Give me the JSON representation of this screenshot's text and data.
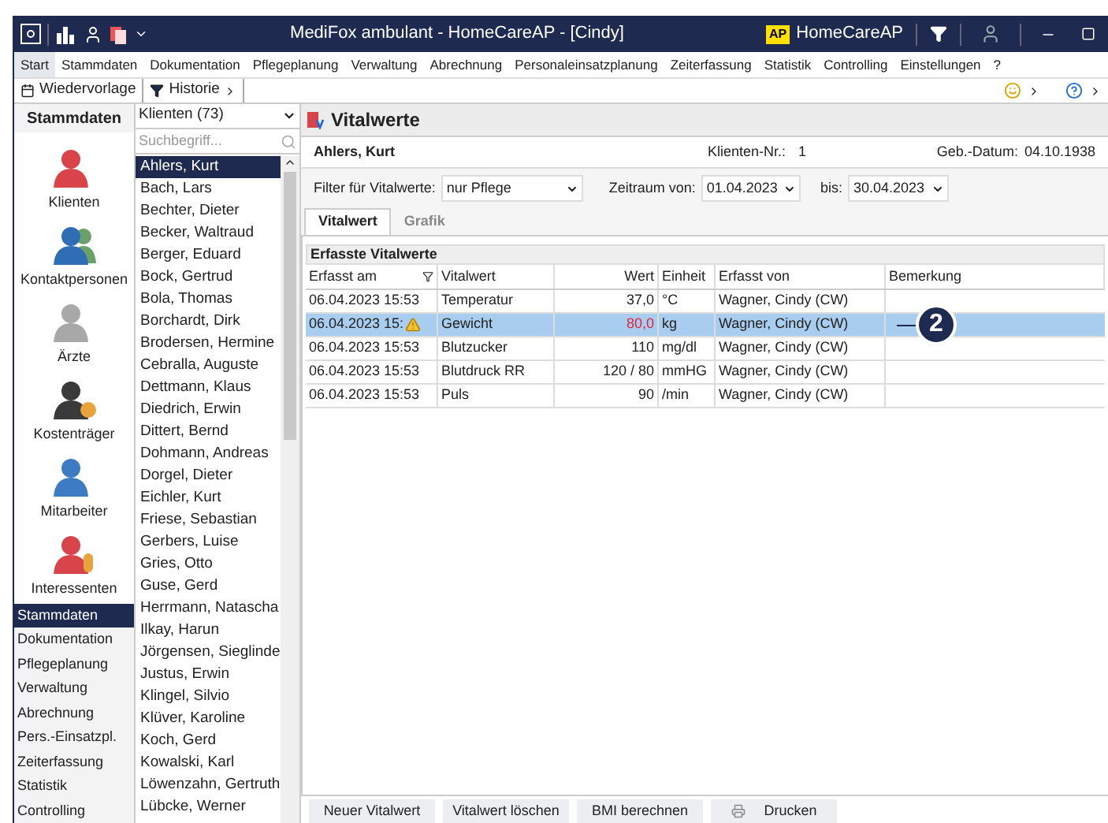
{
  "window": {
    "title": "MediFox ambulant  -  HomeCareAP - [Cindy]",
    "badge": "AP",
    "account": "HomeCareAP"
  },
  "menu": [
    {
      "label": "Start",
      "selected": true
    },
    {
      "label": "Stammdaten",
      "selected": false
    },
    {
      "label": "Dokumentation",
      "selected": false
    },
    {
      "label": "Pflegeplanung",
      "selected": false
    },
    {
      "label": "Verwaltung",
      "selected": false
    },
    {
      "label": "Abrechnung",
      "selected": false
    },
    {
      "label": "Personaleinsatzplanung",
      "selected": false
    },
    {
      "label": "Zeiterfassung",
      "selected": false
    },
    {
      "label": "Statistik",
      "selected": false
    },
    {
      "label": "Controlling",
      "selected": false
    },
    {
      "label": "Einstellungen",
      "selected": false
    },
    {
      "label": "?",
      "selected": false
    }
  ],
  "toolbar": [
    {
      "label": "Wiedervorlage",
      "kind": "calendar"
    },
    {
      "label": "Historie",
      "kind": "filter"
    }
  ],
  "nav": {
    "header": "Stammdaten",
    "modules": [
      {
        "label": "Klienten",
        "kind": "client"
      },
      {
        "label": "Kontaktpersonen",
        "kind": "contacts"
      },
      {
        "label": "Ärzte",
        "kind": "doctor"
      },
      {
        "label": "Kostenträger",
        "kind": "payer"
      },
      {
        "label": "Mitarbeiter",
        "kind": "staff"
      },
      {
        "label": "Interessenten",
        "kind": "prospect"
      }
    ],
    "sections": [
      {
        "label": "Stammdaten",
        "selected": true
      },
      {
        "label": "Dokumentation",
        "selected": false
      },
      {
        "label": "Pflegeplanung",
        "selected": false
      },
      {
        "label": "Verwaltung",
        "selected": false
      },
      {
        "label": "Abrechnung",
        "selected": false
      },
      {
        "label": "Pers.-Einsatzpl.",
        "selected": false
      },
      {
        "label": "Zeiterfassung",
        "selected": false
      },
      {
        "label": "Statistik",
        "selected": false
      },
      {
        "label": "Controlling",
        "selected": false
      }
    ]
  },
  "clients": {
    "dropdown": "Klienten (73)",
    "placeholder": "Suchbegriff...",
    "items": [
      {
        "name": "Ahlers, Kurt",
        "selected": true
      },
      {
        "name": "Bach, Lars",
        "selected": false
      },
      {
        "name": "Bechter, Dieter",
        "selected": false
      },
      {
        "name": "Becker, Waltraud",
        "selected": false
      },
      {
        "name": "Berger, Eduard",
        "selected": false
      },
      {
        "name": "Bock, Gertrud",
        "selected": false
      },
      {
        "name": "Bola, Thomas",
        "selected": false
      },
      {
        "name": "Borchardt, Dirk",
        "selected": false
      },
      {
        "name": "Brodersen, Hermine",
        "selected": false
      },
      {
        "name": "Cebralla, Auguste",
        "selected": false
      },
      {
        "name": "Dettmann, Klaus",
        "selected": false
      },
      {
        "name": "Diedrich, Erwin",
        "selected": false
      },
      {
        "name": "Dittert, Bernd",
        "selected": false
      },
      {
        "name": "Dohmann, Andreas",
        "selected": false
      },
      {
        "name": "Dorgel, Dieter",
        "selected": false
      },
      {
        "name": "Eichler, Kurt",
        "selected": false
      },
      {
        "name": "Friese, Sebastian",
        "selected": false
      },
      {
        "name": "Gerbers, Luise",
        "selected": false
      },
      {
        "name": "Gries, Otto",
        "selected": false
      },
      {
        "name": "Guse, Gerd",
        "selected": false
      },
      {
        "name": "Herrmann, Natascha",
        "selected": false
      },
      {
        "name": "Ilkay, Harun",
        "selected": false
      },
      {
        "name": "Jörgensen, Sieglinde",
        "selected": false
      },
      {
        "name": "Justus, Erwin",
        "selected": false
      },
      {
        "name": "Klingel, Silvio",
        "selected": false
      },
      {
        "name": "Klüver, Karoline",
        "selected": false
      },
      {
        "name": "Koch, Gerd",
        "selected": false
      },
      {
        "name": "Kowalski, Karl",
        "selected": false
      },
      {
        "name": "Löwenzahn, Gertruth",
        "selected": false
      },
      {
        "name": "Lübcke, Werner",
        "selected": false
      }
    ]
  },
  "vitals": {
    "title": "Vitalwerte",
    "patient": "Ahlers, Kurt",
    "client_no_label": "Klienten-Nr.:",
    "client_no": "1",
    "birth_label": "Geb.-Datum:",
    "birth": "04.10.1938",
    "filter_label": "Filter für Vitalwerte:",
    "filter": "nur Pflege",
    "from_label": "Zeitraum von:",
    "from": "01.04.2023",
    "to_label": "bis:",
    "to": "30.04.2023",
    "tabs": [
      {
        "label": "Vitalwert",
        "selected": true
      },
      {
        "label": "Grafik",
        "selected": false
      }
    ],
    "table_title": "Erfasste Vitalwerte",
    "columns": [
      "Erfasst am",
      "Vitalwert",
      "Wert",
      "Einheit",
      "Erfasst von",
      "Bemerkung"
    ],
    "rows": [
      {
        "date": "06.04.2023 15:53",
        "warning": false,
        "name": "Temperatur",
        "value": "37,0",
        "alert": false,
        "unit": "°C",
        "by": "Wagner, Cindy (CW)",
        "selected": false
      },
      {
        "date": "06.04.2023 15:",
        "warning": true,
        "name": "Gewicht",
        "value": "80,0",
        "alert": true,
        "unit": "kg",
        "by": "Wagner, Cindy (CW)",
        "selected": true
      },
      {
        "date": "06.04.2023 15:53",
        "warning": false,
        "name": "Blutzucker",
        "value": "110",
        "alert": false,
        "unit": "mg/dl",
        "by": "Wagner, Cindy (CW)",
        "selected": false
      },
      {
        "date": "06.04.2023 15:53",
        "warning": false,
        "name": "Blutdruck RR",
        "value": "120 / 80",
        "alert": false,
        "unit": "mmHG",
        "by": "Wagner, Cindy (CW)",
        "selected": false
      },
      {
        "date": "06.04.2023 15:53",
        "warning": false,
        "name": "Puls",
        "value": "90",
        "alert": false,
        "unit": "/min",
        "by": "Wagner, Cindy (CW)",
        "selected": false
      }
    ],
    "callout": "2",
    "buttons": [
      {
        "label": "Neuer Vitalwert",
        "kind": "plain"
      },
      {
        "label": "Vitalwert löschen",
        "kind": "plain"
      },
      {
        "label": "BMI berechnen",
        "kind": "plain"
      },
      {
        "label": "Drucken",
        "kind": "print"
      }
    ]
  }
}
